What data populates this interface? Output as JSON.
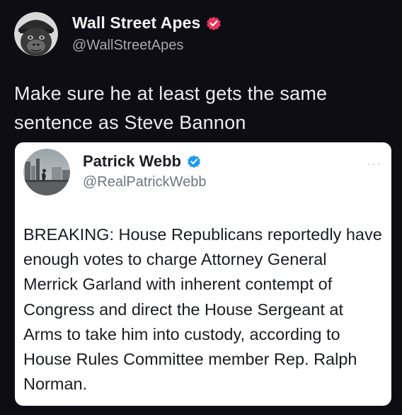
{
  "post": {
    "author_name": "Wall Street Apes",
    "author_handle": "@WallStreetApes",
    "text": "Make sure he at least gets the same sentence as Steve Bannon",
    "avatar_icon": "gorilla-avatar-icon",
    "verified_icon": "verified-badge-icon",
    "verified_color": "#e8365d"
  },
  "quote": {
    "author_name": "Patrick Webb",
    "author_handle": "@RealPatrickWebb",
    "text": "BREAKING: House Republicans reportedly have enough votes to charge Attorney General Merrick Garland with inherent contempt of Congress and direct the House Sergeant at Arms to take him into custody, according to House Rules Committee member Rep. Ralph Norman.",
    "more_label": "···",
    "avatar_icon": "profile-photo-icon",
    "verified_icon": "verified-badge-icon",
    "verified_color": "#1d9bf0"
  },
  "colors": {
    "background": "#0e0d14",
    "card_background": "#ffffff"
  }
}
